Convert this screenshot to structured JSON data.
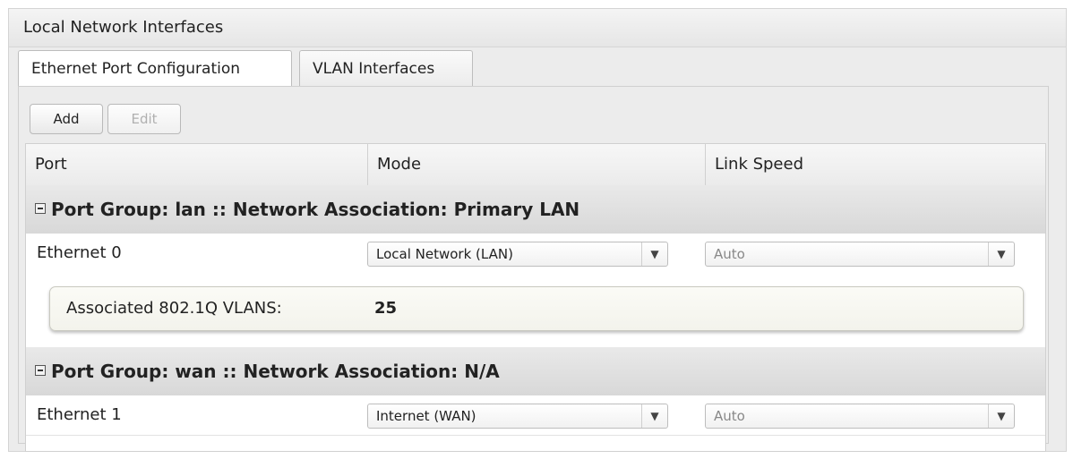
{
  "panel": {
    "title": "Local Network Interfaces"
  },
  "tabs": [
    {
      "label": "Ethernet Port Configuration",
      "active": true
    },
    {
      "label": "VLAN Interfaces",
      "active": false
    }
  ],
  "toolbar": {
    "add_label": "Add",
    "edit_label": "Edit",
    "edit_disabled": true
  },
  "table": {
    "columns": [
      "Port",
      "Mode",
      "Link Speed"
    ],
    "groups": [
      {
        "title": "Port Group: lan :: Network Association: Primary LAN",
        "rows": [
          {
            "port": "Ethernet 0",
            "mode": "Local Network (LAN)",
            "link_speed": "Auto"
          }
        ],
        "vlans": {
          "label": "Associated 802.1Q VLANS:",
          "value": "25"
        }
      },
      {
        "title": "Port Group: wan :: Network Association: N/A",
        "rows": [
          {
            "port": "Ethernet 1",
            "mode": "Internet (WAN)",
            "link_speed": "Auto"
          }
        ]
      }
    ]
  },
  "icons": {
    "collapse": "collapse-minus-icon",
    "dropdown": "chevron-down-icon"
  }
}
